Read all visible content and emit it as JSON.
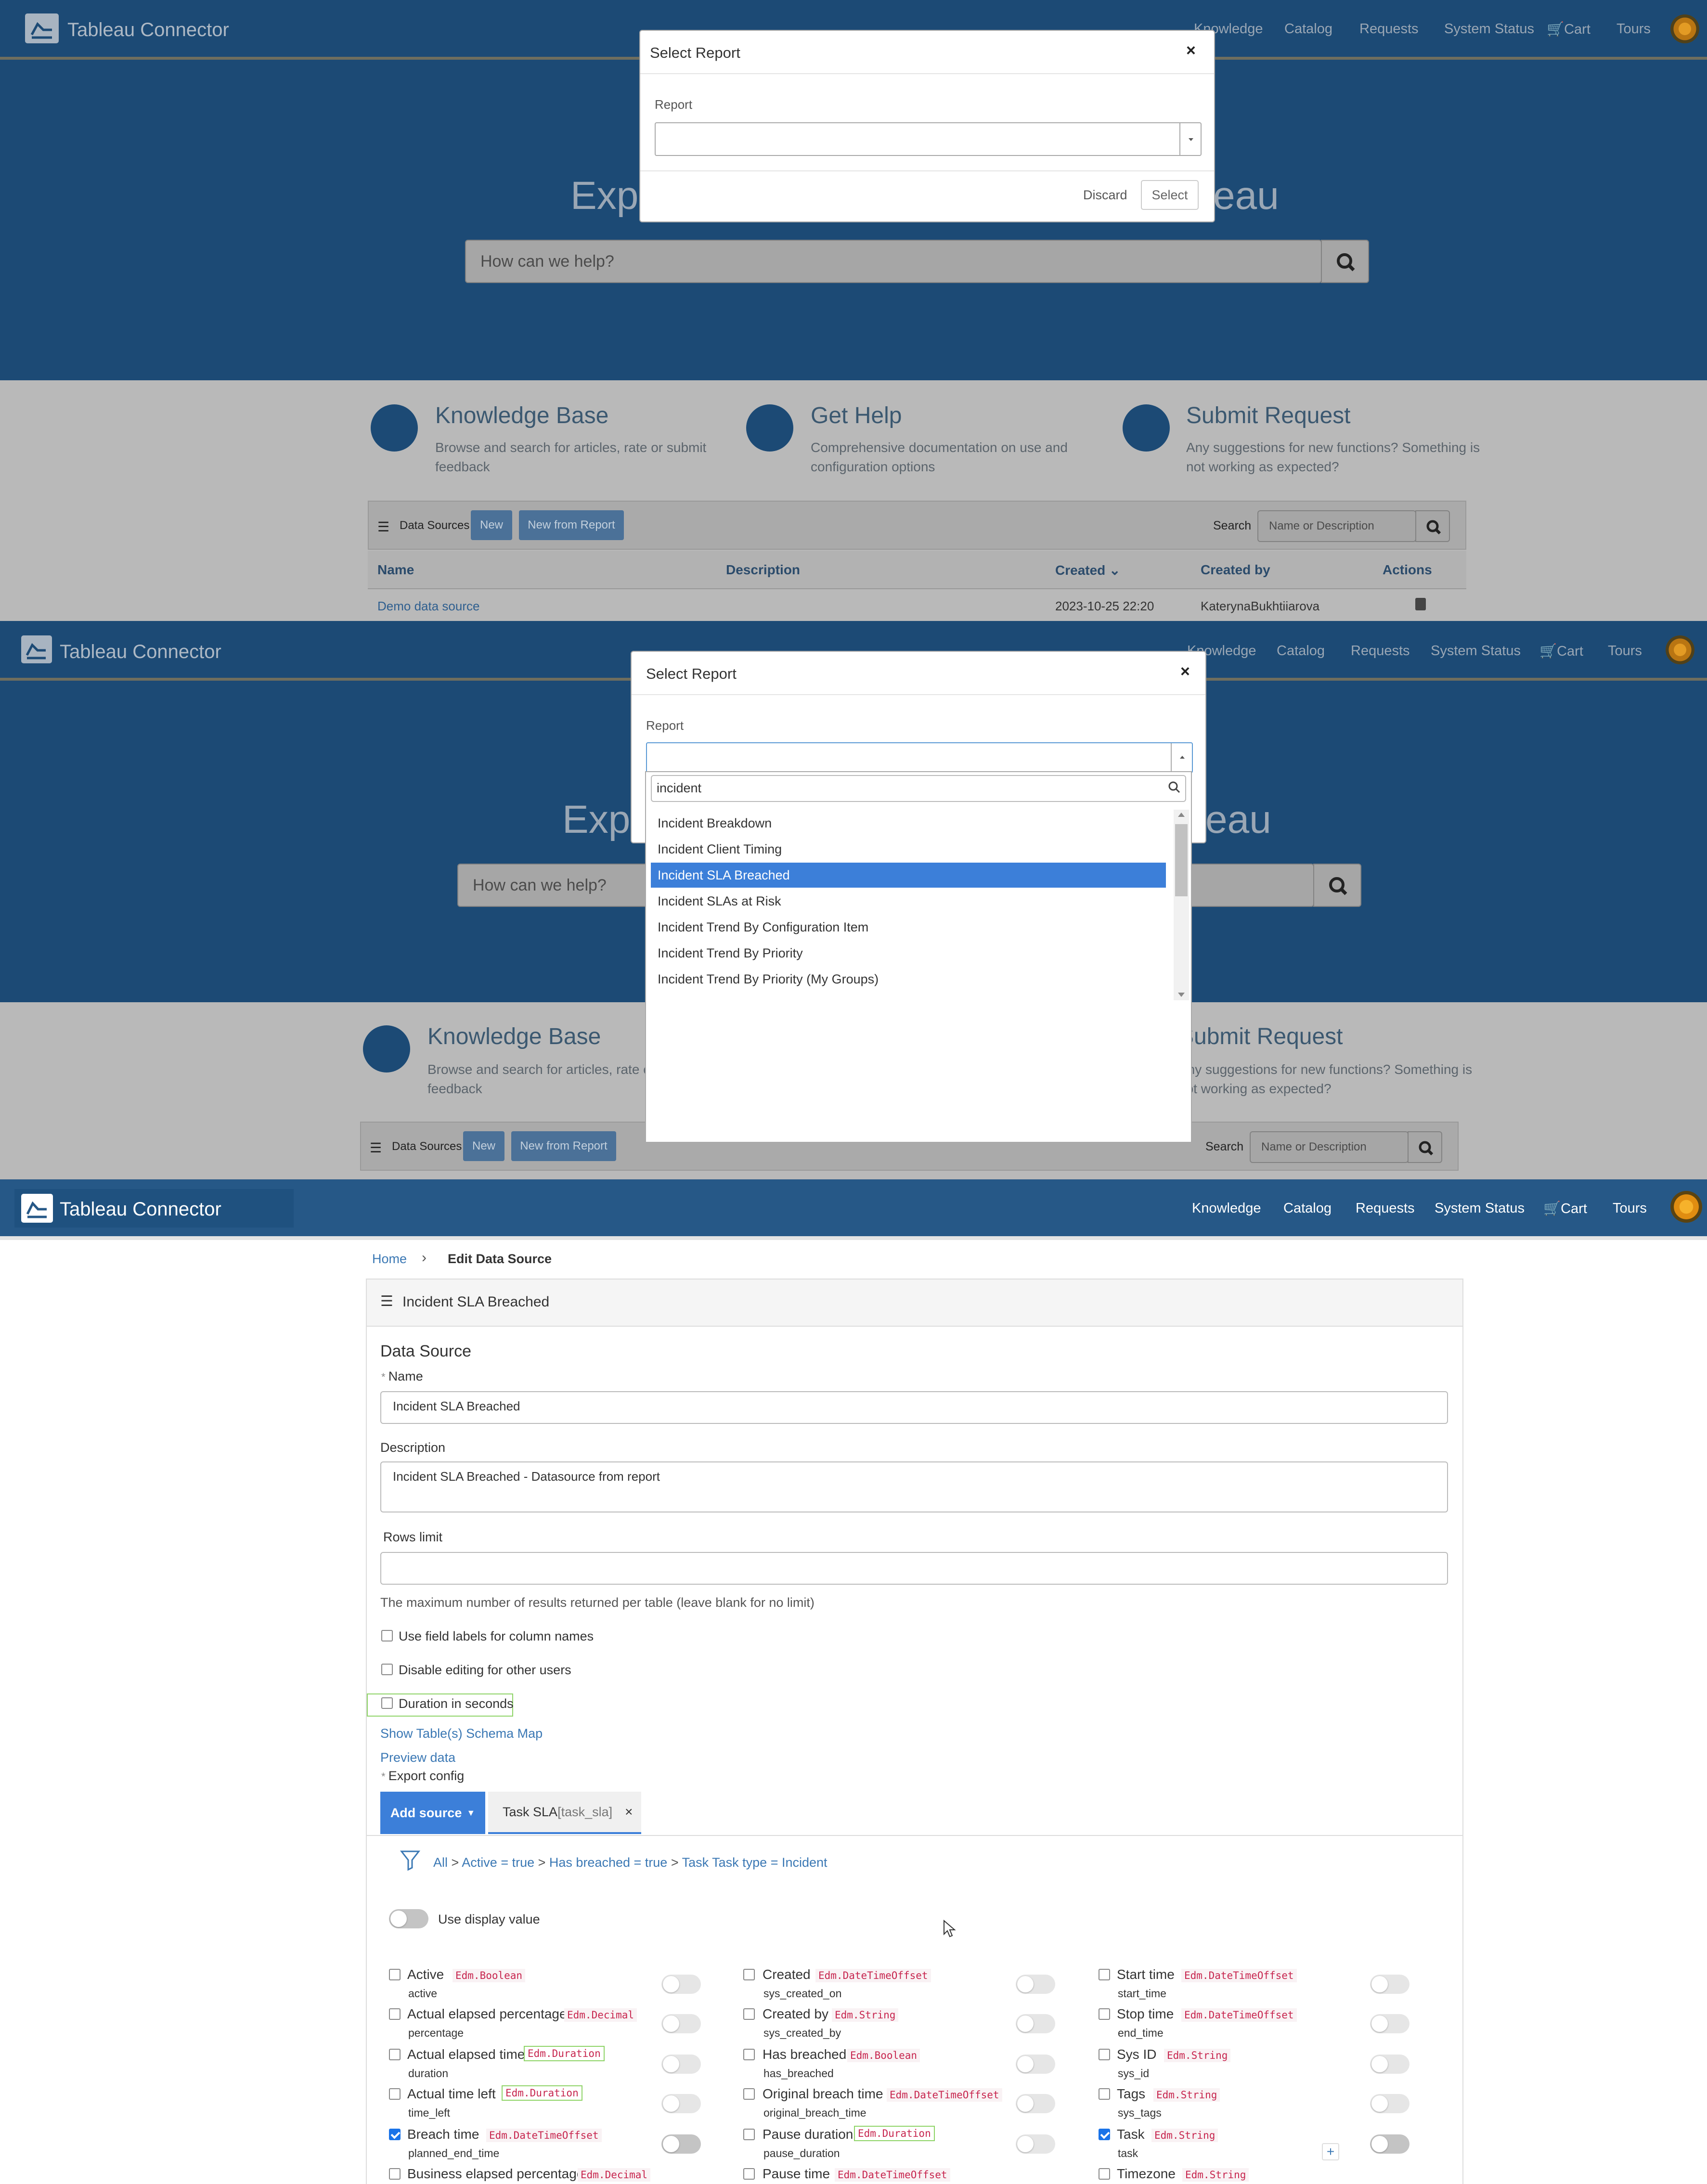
{
  "brand": {
    "name": "Tableau Connector"
  },
  "nav": {
    "knowledge": "Knowledge",
    "catalog": "Catalog",
    "requests": "Requests",
    "system_status": "System Status",
    "cart": "Cart",
    "tours": "Tours"
  },
  "hero": {
    "title_left": "Expl",
    "title_right": "eau",
    "search_placeholder": "How can we help?"
  },
  "cards": [
    {
      "title": "Knowledge Base",
      "desc1": "Browse and search for articles, rate or submit",
      "desc2": "feedback"
    },
    {
      "title": "Get Help",
      "desc1": "Comprehensive documentation on use and",
      "desc2": "configuration options"
    },
    {
      "title": "Submit Request",
      "desc1": "Any suggestions for new functions? Something is",
      "desc2": "not working as expected?"
    }
  ],
  "datasources": {
    "title": "Data Sources",
    "new_btn": "New",
    "new_from_report_btn": "New from Report",
    "search_label": "Search",
    "search_placeholder": "Name or Description",
    "columns": {
      "name": "Name",
      "description": "Description",
      "created": "Created",
      "created_by": "Created by",
      "actions": "Actions"
    },
    "row": {
      "name": "Demo data source",
      "created": "2023-10-25 22:20",
      "created_by": "KaterynaBukhtiiarova"
    }
  },
  "modal": {
    "title": "Select Report",
    "close": "×",
    "label": "Report",
    "discard": "Discard",
    "select": "Select"
  },
  "dropdown": {
    "search_value": "incident",
    "items": [
      "Incident Breakdown",
      "Incident Client Timing",
      "Incident SLA Breached",
      "Incident SLAs at Risk",
      "Incident Trend By Configuration Item",
      "Incident Trend By Priority",
      "Incident Trend By Priority (My Groups)"
    ],
    "selected_index": 2
  },
  "editor": {
    "breadcrumb": {
      "home": "Home",
      "current": "Edit Data Source"
    },
    "panel_title": "Incident SLA Breached",
    "section_title": "Data Source",
    "name_label": "Name",
    "name_value": "Incident SLA Breached",
    "description_label": "Description",
    "description_value": "Incident SLA Breached - Datasource from report",
    "rows_limit_label": "Rows limit",
    "rows_limit_value": "",
    "rows_limit_help": "The maximum number of results returned per table (leave blank for no limit)",
    "options": [
      {
        "label": "Use field labels for column names",
        "checked": false
      },
      {
        "label": "Disable editing for other users",
        "checked": false
      },
      {
        "label": "Duration in seconds",
        "checked": false
      }
    ],
    "schema_link": "Show Table(s) Schema Map",
    "preview_link": "Preview data",
    "export_label": "Export config",
    "add_source": "Add source",
    "tab_name": "Task SLA",
    "tab_table": "[task_sla]",
    "filter": {
      "all": "All",
      "c1": "Active = true",
      "c2": "Has breached = true",
      "c3": "Task Task type = Incident"
    },
    "use_display_value": "Use display value",
    "fields": [
      [
        {
          "name": "Active",
          "type": "Edm.Boolean",
          "key": "active",
          "checked": false
        },
        {
          "name": "Actual elapsed percentage",
          "type": "Edm.Decimal",
          "key": "percentage",
          "checked": false
        },
        {
          "name": "Actual elapsed time",
          "type": "Edm.Duration",
          "key": "duration",
          "checked": false
        },
        {
          "name": "Actual time left",
          "type": "Edm.Duration",
          "key": "time_left",
          "checked": false
        },
        {
          "name": "Breach time",
          "type": "Edm.DateTimeOffset",
          "key": "planned_end_time",
          "checked": true
        },
        {
          "name": "Business elapsed percentage",
          "type": "Edm.Decimal",
          "key": "",
          "checked": false
        }
      ],
      [
        {
          "name": "Created",
          "type": "Edm.DateTimeOffset",
          "key": "sys_created_on",
          "checked": false
        },
        {
          "name": "Created by",
          "type": "Edm.String",
          "key": "sys_created_by",
          "checked": false
        },
        {
          "name": "Has breached",
          "type": "Edm.Boolean",
          "key": "has_breached",
          "checked": false
        },
        {
          "name": "Original breach time",
          "type": "Edm.DateTimeOffset",
          "key": "original_breach_time",
          "checked": false
        },
        {
          "name": "Pause duration",
          "type": "Edm.Duration",
          "key": "pause_duration",
          "checked": false
        },
        {
          "name": "Pause time",
          "type": "Edm.DateTimeOffset",
          "key": "",
          "checked": false
        }
      ],
      [
        {
          "name": "Start time",
          "type": "Edm.DateTimeOffset",
          "key": "start_time",
          "checked": false
        },
        {
          "name": "Stop time",
          "type": "Edm.DateTimeOffset",
          "key": "end_time",
          "checked": false
        },
        {
          "name": "Sys ID",
          "type": "Edm.String",
          "key": "sys_id",
          "checked": false
        },
        {
          "name": "Tags",
          "type": "Edm.String",
          "key": "sys_tags",
          "checked": false
        },
        {
          "name": "Task",
          "type": "Edm.String",
          "key": "task",
          "checked": true
        },
        {
          "name": "Timezone",
          "type": "Edm.String",
          "key": "",
          "checked": false
        }
      ]
    ],
    "task_plus": "+"
  },
  "colors": {
    "brand": "#265887",
    "hero_dimmed": "#1c4a75",
    "selected": "#3c7fd9",
    "type_text": "#c7254e",
    "highlight_box": "#8fd468"
  }
}
